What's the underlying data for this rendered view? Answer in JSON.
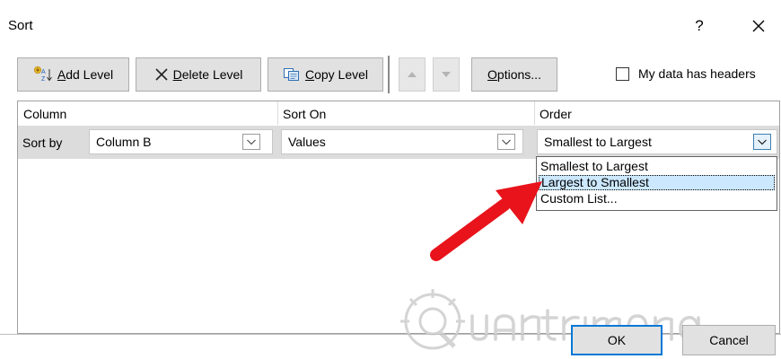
{
  "window": {
    "title": "Sort",
    "help_label": "?"
  },
  "toolbar": {
    "add_level": {
      "accel": "A",
      "rest": "dd Level"
    },
    "delete_level": {
      "accel": "D",
      "rest": "elete Level"
    },
    "copy_level": {
      "accel": "C",
      "rest": "opy Level"
    },
    "options": {
      "accel": "O",
      "rest": "ptions..."
    },
    "my_data_headers": {
      "prefix": "My data has ",
      "accel": "h",
      "rest": "eaders",
      "checked": false
    }
  },
  "grid": {
    "headers": {
      "column": "Column",
      "sort_on": "Sort On",
      "order": "Order"
    },
    "row": {
      "label": "Sort by",
      "column_value": "Column B",
      "sort_on_value": "Values",
      "order_value": "Smallest to Largest"
    }
  },
  "order_dropdown": {
    "options": [
      "Smallest to Largest",
      "Largest to Smallest",
      "Custom List..."
    ],
    "highlighted": "Largest to Smallest"
  },
  "footer": {
    "ok": "OK",
    "cancel": "Cancel"
  },
  "colors": {
    "selection": "#cce8ff",
    "focus_border": "#0078d7",
    "annotation_arrow": "#e8131b",
    "grid_row": "#dcdcdc"
  }
}
